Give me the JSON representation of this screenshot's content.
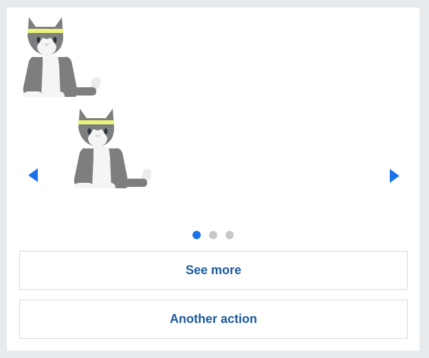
{
  "colors": {
    "accent": "#1a73e8",
    "link_text": "#1b5a9e",
    "dot_inactive": "#c8c8c8",
    "headband": "#e8f57a"
  },
  "header_image": {
    "icon": "cat-with-headband-icon"
  },
  "carousel": {
    "slide_icon": "cat-with-headband-icon",
    "prev_icon": "chevron-left-icon",
    "next_icon": "chevron-right-icon",
    "page_count": 3,
    "active_page": 1
  },
  "actions": {
    "primary_label": "See more",
    "secondary_label": "Another action"
  }
}
